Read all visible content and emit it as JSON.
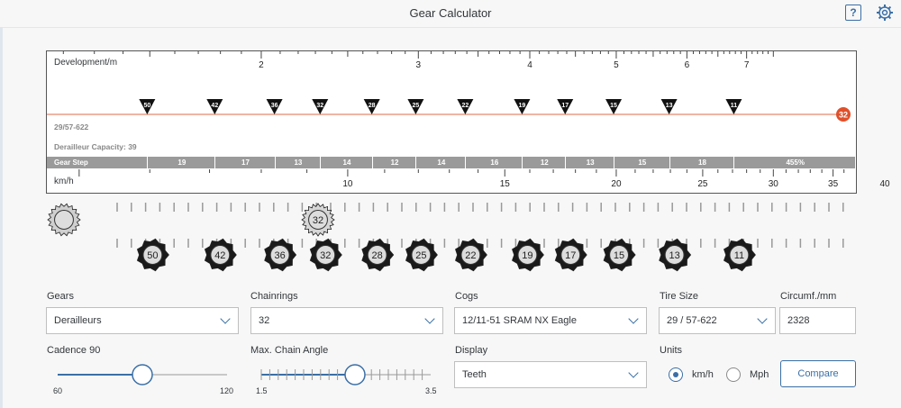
{
  "app": {
    "title": "Gear Calculator"
  },
  "chart": {
    "development_label": "Development/m",
    "development_ticks": [
      "2",
      "3",
      "4",
      "5",
      "6",
      "7"
    ],
    "tire_label": "29/57-622",
    "derailleur_capacity": "Derailleur Capacity: 39",
    "chainring_badge": "32",
    "cog_markers": [
      "50",
      "42",
      "36",
      "32",
      "28",
      "25",
      "22",
      "19",
      "17",
      "15",
      "13",
      "11"
    ],
    "gear_step_label": "Gear Step",
    "gear_steps": [
      "19",
      "17",
      "13",
      "14",
      "12",
      "14",
      "16",
      "12",
      "13",
      "15",
      "18",
      "455%"
    ],
    "speed_label": "km/h",
    "speed_ticks": [
      "10",
      "15",
      "20",
      "25",
      "30",
      "35",
      "40"
    ]
  },
  "drivetrain": {
    "chainring": "32",
    "cogs": [
      "11",
      "13",
      "15",
      "17",
      "19",
      "22",
      "25",
      "28",
      "32",
      "36",
      "42",
      "50"
    ]
  },
  "controls": {
    "gears": {
      "label": "Gears",
      "value": "Derailleurs"
    },
    "chainrings": {
      "label": "Chainrings",
      "value": "32"
    },
    "cogs": {
      "label": "Cogs",
      "value": "12/11-51 SRAM NX Eagle"
    },
    "tire_size": {
      "label": "Tire Size",
      "value": "29 / 57-622"
    },
    "circumference": {
      "label": "Circumf./mm",
      "value": "2328"
    },
    "cadence": {
      "label": "Cadence 90",
      "min": "60",
      "max": "120",
      "value_fraction": 0.5
    },
    "chain_angle": {
      "label": "Max. Chain Angle",
      "min": "1.5",
      "max": "3.5",
      "value_fraction": 0.55
    },
    "display": {
      "label": "Display",
      "value": "Teeth"
    },
    "units": {
      "label": "Units",
      "options": [
        "km/h",
        "Mph"
      ],
      "selected": "km/h"
    },
    "compare_label": "Compare"
  },
  "colors": {
    "accent": "#3a6fa6",
    "marker": "#e0502a",
    "redline": "#e06a4a",
    "gearstep_bg": "#9a9a9a"
  }
}
